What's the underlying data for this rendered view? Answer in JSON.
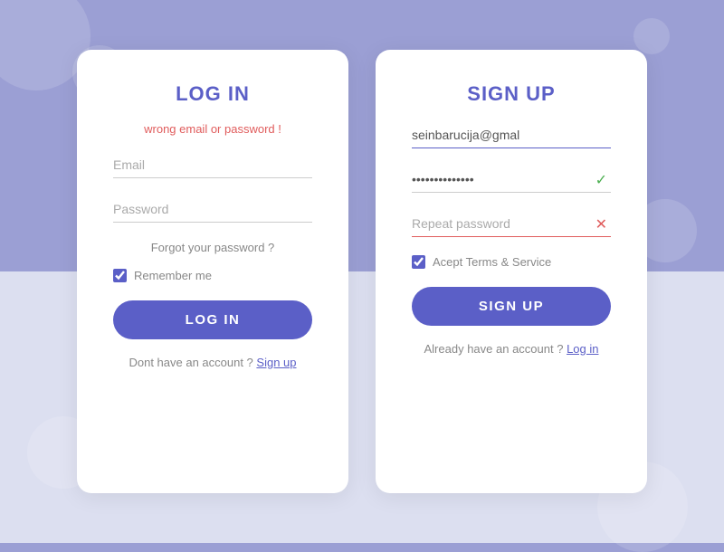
{
  "background": {
    "topColor": "#9b9fd4",
    "bottomColor": "#dcdff0"
  },
  "login": {
    "title": "LOG IN",
    "error": "wrong email or password !",
    "email_placeholder": "Email",
    "password_placeholder": "Password",
    "forgot_label": "Forgot your password ?",
    "remember_label": "Remember me",
    "button_label": "LOG IN",
    "no_account_text": "Dont have an account ?",
    "signup_link": "Sign up"
  },
  "signup": {
    "title": "SIGN UP",
    "email_value": "seinbarucija@gmal",
    "password_value": "**************",
    "repeat_placeholder": "Repeat password",
    "terms_label": "Acept Terms & Service",
    "button_label": "SIGN UP",
    "have_account_text": "Already have an account ?",
    "login_link": "Log in"
  }
}
